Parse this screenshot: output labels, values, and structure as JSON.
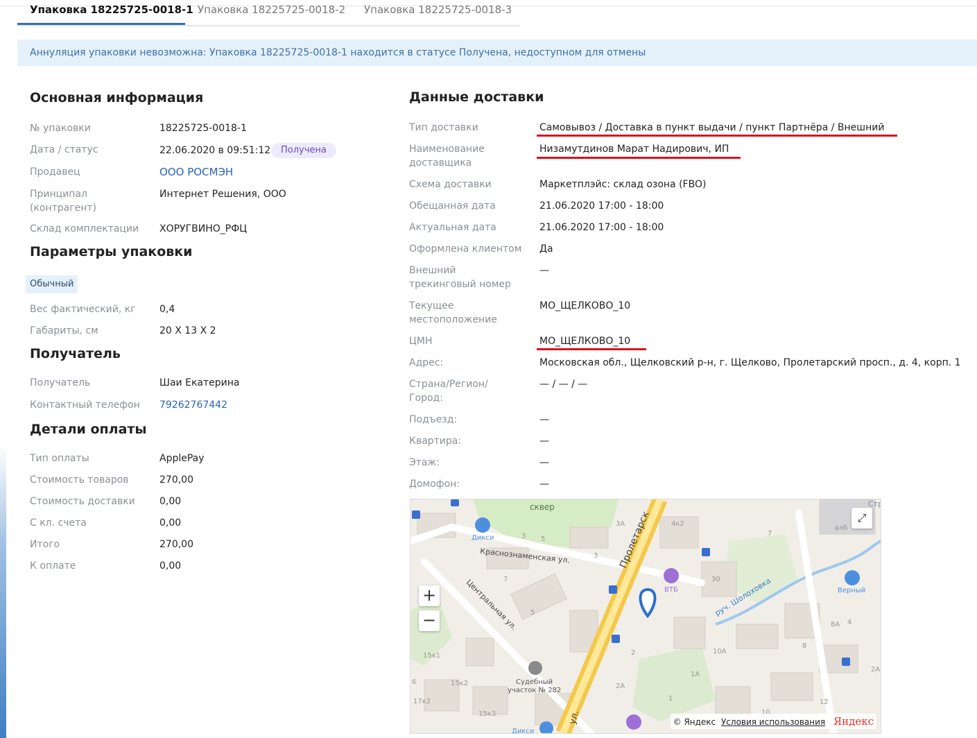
{
  "tabs": [
    {
      "label": "Упаковка 18225725-0018-1",
      "active": true
    },
    {
      "label": "Упаковка 18225725-0018-2",
      "active": false
    },
    {
      "label": "Упаковка 18225725-0018-3",
      "active": false
    }
  ],
  "banner": {
    "text": "Аннуляция упаковки невозможна: Упаковка 18225725-0018-1 находится в статусе Получена, недоступном для отмены"
  },
  "main_info": {
    "title": "Основная информация",
    "package_no_label": "№ упаковки",
    "package_no_value": "18225725-0018-1",
    "date_status_label": "Дата / статус",
    "date_value": "22.06.2020 в 09:51:12",
    "status_badge": "Получена",
    "seller_label": "Продавец",
    "seller_value": "ООО РОСМЭН",
    "principal_label": "Принципал (контрагент)",
    "principal_value": "Интернет Решения, ООО",
    "warehouse_label": "Склад комплектации",
    "warehouse_value": "ХОРУГВИНО_РФЦ"
  },
  "package_params": {
    "title": "Параметры упаковки",
    "type_chip": "Обычный",
    "weight_label": "Вес фактический, кг",
    "weight_value": "0,4",
    "dims_label": "Габариты, см",
    "dims_value": "20 X 13 X 2"
  },
  "recipient": {
    "title": "Получатель",
    "name_label": "Получатель",
    "name_value": "Шаи Екатерина",
    "phone_label": "Контактный телефон",
    "phone_value": "79262767442"
  },
  "payment": {
    "title": "Детали оплаты",
    "rows": [
      {
        "label": "Тип оплаты",
        "value": "ApplePay"
      },
      {
        "label": "Стоимость товаров",
        "value": "270,00"
      },
      {
        "label": "Стоимость доставки",
        "value": "0,00"
      },
      {
        "label": "С кл. счета",
        "value": "0,00"
      },
      {
        "label": "Итого",
        "value": "270,00"
      },
      {
        "label": "К оплате",
        "value": "0,00"
      }
    ]
  },
  "delivery": {
    "title": "Данные доставки",
    "rows": [
      {
        "label": "Тип доставки",
        "value": "Самовывоз / Доставка в пункт выдачи / пункт Партнёра / Внешний"
      },
      {
        "label": "Наименование доставщика",
        "value": "Низамутдинов Марат Надирович, ИП"
      },
      {
        "label": "Схема доставки",
        "value": "Маркетплэйс: склад озона (FBO)"
      },
      {
        "label": "Обещанная дата",
        "value": "21.06.2020 17:00 - 18:00"
      },
      {
        "label": "Актуальная дата",
        "value": "21.06.2020 17:00 - 18:00"
      },
      {
        "label": "Оформлена клиентом",
        "value": "Да"
      },
      {
        "label": "Внешний трекинговый номер",
        "value": "—"
      },
      {
        "label": "Текущее местоположение",
        "value": "МО_ЩЕЛКОВО_10"
      },
      {
        "label": "ЦМН",
        "value": "МО_ЩЕЛКОВО_10"
      },
      {
        "label": "Адрес:",
        "value": "Московская обл., Щелковский р-н, г. Щелково, Пролетарский просп., д. 4, корп. 1"
      },
      {
        "label": "Страна/Регион/ Город:",
        "value": "— / — / —"
      },
      {
        "label": "Подъезд:",
        "value": "—"
      },
      {
        "label": "Квартира:",
        "value": "—"
      },
      {
        "label": "Этаж:",
        "value": "—"
      },
      {
        "label": "Домофон:",
        "value": "—"
      }
    ]
  },
  "map": {
    "labels": {
      "park": "сквер",
      "street1": "Пролетарск",
      "street2": "Краснознаменская ул.",
      "street3": "Центральная ул.",
      "creek": "руч. Шолоховка",
      "shop1": "Дикси",
      "shop2": "Верный",
      "shop3": "Дикси",
      "bank": "ВТБ",
      "court": "Судебный участок № 282",
      "road_short": "ул.",
      "corner": "Стро"
    },
    "house_numbers": [
      "3А",
      "4к2",
      "7",
      "3",
      "5",
      "30",
      "3",
      "7",
      "5",
      "8А",
      "4",
      "10А",
      "1А",
      "2А",
      "12",
      "1",
      "10",
      "15к1",
      "15к2",
      "15к3",
      "6",
      "17к2",
      "2",
      "8",
      "2А",
      "влб"
    ],
    "zoom_in": "+",
    "zoom_out": "−",
    "expand_icon": "⤢",
    "credit": "© Яндекс",
    "terms": "Условия использования",
    "logo": "Яндекс"
  }
}
